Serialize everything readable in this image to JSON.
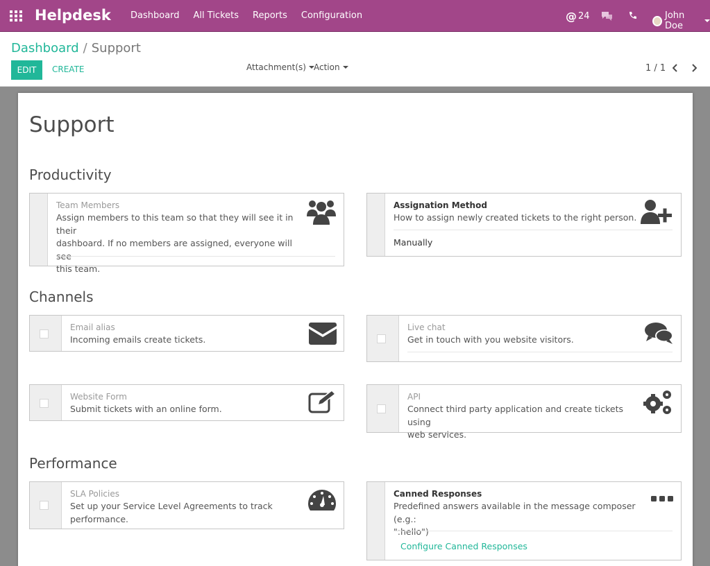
{
  "navbar": {
    "brand": "Helpdesk",
    "menu": [
      "Dashboard",
      "All Tickets",
      "Reports",
      "Configuration"
    ],
    "mention_count": "24",
    "user_name": "John Doe",
    "color": "#a24689"
  },
  "control_panel": {
    "breadcrumb_parent": "Dashboard",
    "breadcrumb_current": "Support",
    "edit_label": "EDIT",
    "create_label": "CREATE",
    "attachments_label": "Attachment(s)",
    "action_label": "Action",
    "pager": "1 / 1",
    "accent": "#21b799"
  },
  "form": {
    "title": "Support",
    "sections": {
      "productivity": "Productivity",
      "channels": "Channels",
      "performance": "Performance"
    },
    "team_members": {
      "label": "Team Members",
      "description": [
        "Assign members to this team so that they will see it in their",
        "dashboard. If no members are assigned, everyone will see",
        "this team."
      ],
      "icon": "users-icon"
    },
    "assignation": {
      "label": "Assignation Method",
      "description": "How to assign newly created tickets to the right person.",
      "value": "Manually",
      "icon": "user-plus-icon"
    },
    "email_alias": {
      "label": "Email alias",
      "description": "Incoming emails create tickets.",
      "checked": false,
      "icon": "envelope-icon"
    },
    "live_chat": {
      "label": "Live chat",
      "description": "Get in touch with you website visitors.",
      "checked": false,
      "icon": "comments-icon"
    },
    "website_form": {
      "label": "Website Form",
      "description": "Submit tickets with an online form.",
      "checked": false,
      "icon": "edit-icon"
    },
    "api": {
      "label": "API",
      "description": [
        "Connect third party application and create tickets using",
        "web services."
      ],
      "checked": false,
      "icon": "gears-icon"
    },
    "sla": {
      "label": "SLA Policies",
      "description": [
        "Set up your Service Level Agreements to track",
        "performance."
      ],
      "checked": false,
      "icon": "dashboard-icon"
    },
    "canned": {
      "label": "Canned Responses",
      "description": [
        "Predefined answers available in the message composer (e.g.:",
        "\":hello\")"
      ],
      "link": "Configure Canned Responses",
      "icon": "ellipsis-icon"
    }
  }
}
